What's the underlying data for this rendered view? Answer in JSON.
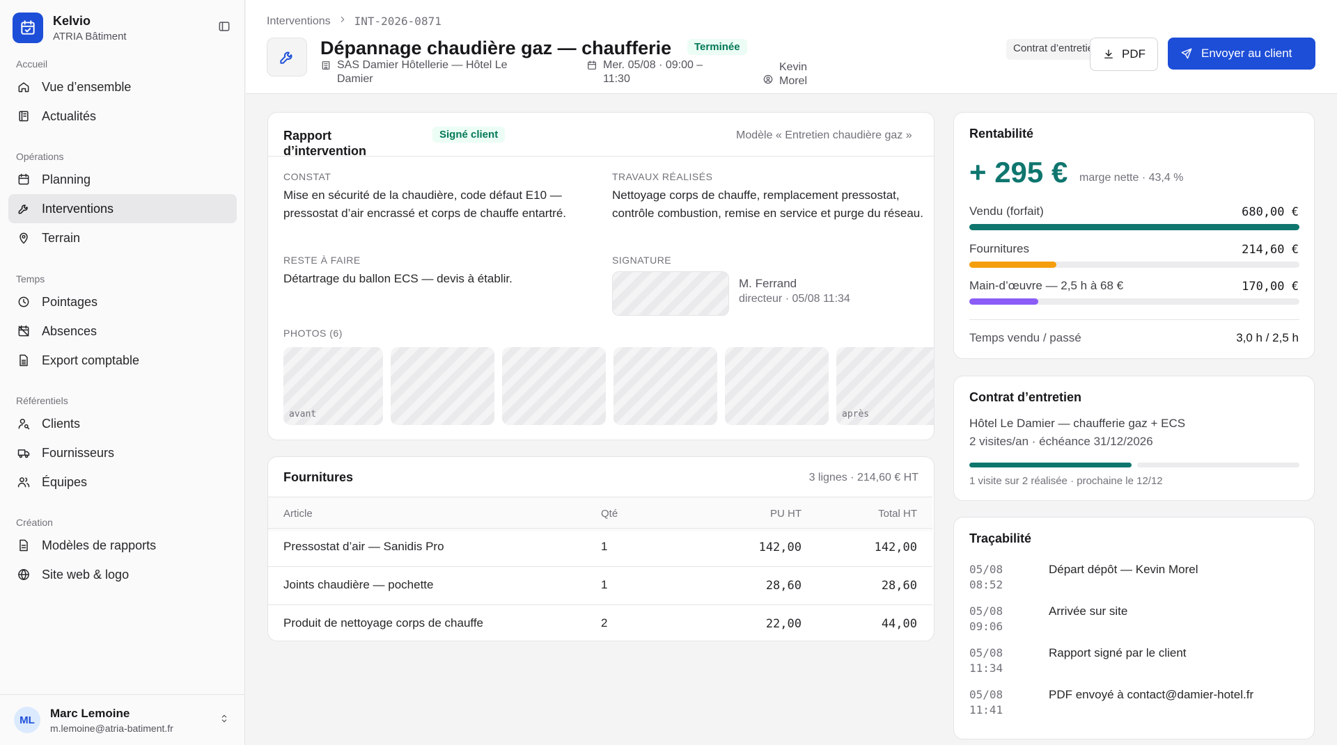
{
  "app": {
    "name": "Kelvio",
    "company": "ATRIA Bâtiment"
  },
  "nav": {
    "sections": [
      {
        "title": "Accueil",
        "items": [
          {
            "label": "Vue d’ensemble"
          },
          {
            "label": "Actualités"
          }
        ]
      },
      {
        "title": "Opérations",
        "items": [
          {
            "label": "Planning"
          },
          {
            "label": "Interventions"
          },
          {
            "label": "Terrain"
          }
        ]
      },
      {
        "title": "Temps",
        "items": [
          {
            "label": "Pointages"
          },
          {
            "label": "Absences"
          },
          {
            "label": "Export comptable"
          }
        ]
      },
      {
        "title": "Référentiels",
        "items": [
          {
            "label": "Clients"
          },
          {
            "label": "Fournisseurs"
          },
          {
            "label": "Équipes"
          }
        ]
      },
      {
        "title": "Création",
        "items": [
          {
            "label": "Modèles de rapports"
          },
          {
            "label": "Site web & logo"
          }
        ]
      }
    ],
    "active": "Interventions"
  },
  "user": {
    "initials": "ML",
    "name": "Marc Lemoine",
    "email": "m.lemoine@atria-batiment.fr"
  },
  "header": {
    "breadcrumb_root": "Interventions",
    "breadcrumb_id": "INT-2026-0871",
    "title": "Dépannage chaudière gaz — chaufferie",
    "status": "Terminée",
    "contract_chip": "Contrat d’entretien",
    "client": "SAS Damier Hôtellerie — Hôtel Le Damier",
    "date": "Mer. 05/08 · 09:00 – 11:30",
    "technician": "Kevin Morel",
    "pdf_label": "PDF",
    "send_label": "Envoyer au client"
  },
  "report": {
    "title": "Rapport d’intervention",
    "badge": "Signé client",
    "template": "Modèle « Entretien chaudière gaz »",
    "constat_label": "CONSTAT",
    "constat": "Mise en sécurité de la chaudière, code défaut E10 — pressostat d’air encrassé et corps de chauffe entartré.",
    "travaux_label": "TRAVAUX RÉALISÉS",
    "travaux": "Nettoyage corps de chauffe, remplacement pressostat, contrôle combustion, remise en service et purge du réseau.",
    "reste_label": "RESTE À FAIRE",
    "reste": "Détartrage du ballon ECS — devis à établir.",
    "signature_label": "SIGNATURE",
    "signer": "M. Ferrand",
    "signer_role": "directeur · 05/08 11:34",
    "photos_label": "PHOTOS (6)",
    "photo_before": "avant",
    "photo_after": "après"
  },
  "supplies": {
    "title": "Fournitures",
    "summary": "3 lignes · 214,60 € HT",
    "columns": [
      "Article",
      "Qté",
      "PU HT",
      "Total HT"
    ],
    "rows": [
      {
        "article": "Pressostat d’air — Sanidis Pro",
        "qty": "1",
        "pu": "142,00",
        "total": "142,00"
      },
      {
        "article": "Joints chaudière — pochette",
        "qty": "1",
        "pu": "28,60",
        "total": "28,60"
      },
      {
        "article": "Produit de nettoyage corps de chauffe",
        "qty": "2",
        "pu": "22,00",
        "total": "44,00"
      }
    ]
  },
  "profit": {
    "title": "Rentabilité",
    "amount": "+ 295 €",
    "caption": "marge nette · 43,4 %",
    "rows": [
      {
        "label": "Vendu (forfait)",
        "value": "680,00 €",
        "fraction": 1.0,
        "color": "#0f766e"
      },
      {
        "label": "Fournitures",
        "value": "214,60 €",
        "fraction": 0.2634,
        "color": "#f59e0b"
      },
      {
        "label": "Main-d’œuvre — 2,5 h à 68 €",
        "value": "170,00 €",
        "fraction": 0.2088,
        "color": "#8b5cf6"
      }
    ],
    "time_label": "Temps vendu / passé",
    "time_value": "3,0 h / 2,5 h"
  },
  "contract": {
    "title": "Contrat d’entretien",
    "name": "Hôtel Le Damier — chaufferie gaz + ECS",
    "terms": "2 visites/an · échéance 31/12/2026",
    "progress": 0.5,
    "note": "1 visite sur 2 réalisée · prochaine le 12/12"
  },
  "trace": {
    "title": "Traçabilité",
    "events": [
      {
        "date": "05/08",
        "time": "08:52",
        "text": "Départ dépôt — Kevin Morel"
      },
      {
        "date": "05/08",
        "time": "09:06",
        "text": "Arrivée sur site"
      },
      {
        "date": "05/08",
        "time": "11:34",
        "text": "Rapport signé par le client"
      },
      {
        "date": "05/08",
        "time": "11:41",
        "text": "PDF envoyé à contact@damier-hotel.fr"
      }
    ]
  },
  "colors": {
    "accent": "#1d4ed8",
    "success": "#047857",
    "profit": "#0f766e"
  }
}
